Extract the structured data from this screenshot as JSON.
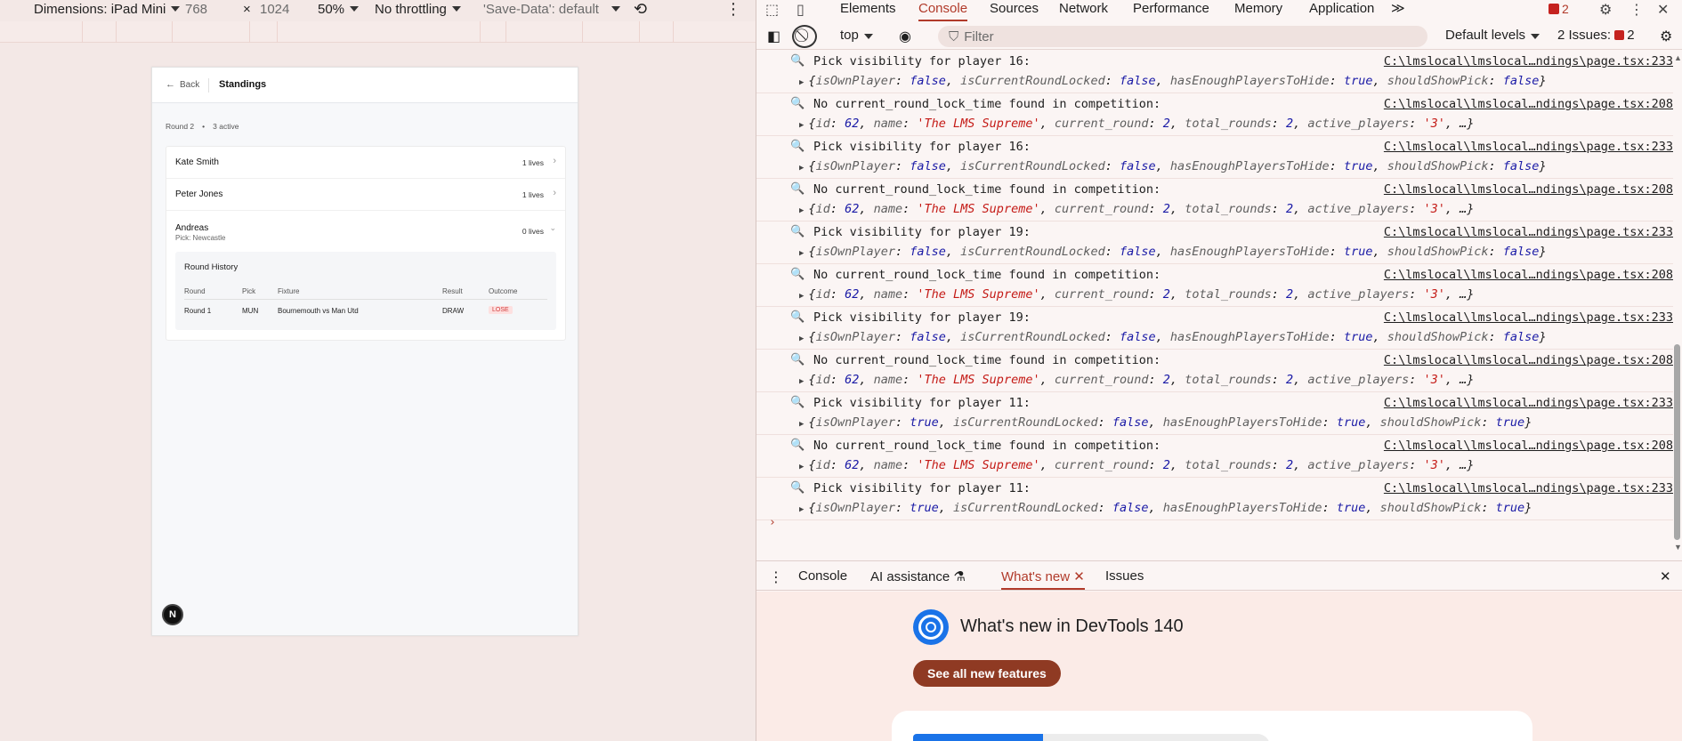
{
  "emulation_toolbar": {
    "dimensions_label": "Dimensions: iPad Mini",
    "width": "768",
    "times": "×",
    "height": "1024",
    "zoom": "50%",
    "throttling": "No throttling",
    "save_data": "'Save-Data': default"
  },
  "app": {
    "back_label": "Back",
    "page_title": "Standings",
    "round_label": "Round 2",
    "separator": "•",
    "active_label": "3 active",
    "players": [
      {
        "name": "Kate Smith",
        "lives": "1 lives"
      },
      {
        "name": "Peter Jones",
        "lives": "1 lives"
      },
      {
        "name": "Andreas",
        "lives": "0 lives",
        "pick": "Pick: Newcastle"
      }
    ],
    "history": {
      "title": "Round History",
      "headers": [
        "Round",
        "Pick",
        "Fixture",
        "Result",
        "Outcome"
      ],
      "rows": [
        {
          "round": "Round 1",
          "pick": "MUN",
          "fixture": "Bournemouth vs Man Utd",
          "result": "DRAW",
          "outcome": "LOSE"
        }
      ]
    },
    "next_badge": "N"
  },
  "devtools": {
    "tabs": [
      "Elements",
      "Console",
      "Sources",
      "Network",
      "Performance",
      "Memory",
      "Application"
    ],
    "active_tab": "Console",
    "more_tabs": "≫",
    "issues_badge": "2",
    "console_toolbar": {
      "context": "top",
      "filter_placeholder": "Filter",
      "levels": "Default levels",
      "issues": "2 Issues:",
      "issues_num": "2"
    },
    "log": [
      {
        "msg": "Pick visibility for player 16:",
        "src": "C:\\lmslocal\\lmslocal…ndings\\page.tsx:233",
        "obj": "pick16"
      },
      {
        "msg": "No current_round_lock_time found in competition:",
        "src": "C:\\lmslocal\\lmslocal…ndings\\page.tsx:208",
        "obj": "comp"
      },
      {
        "msg": "Pick visibility for player 16:",
        "src": "C:\\lmslocal\\lmslocal…ndings\\page.tsx:233",
        "obj": "pick16"
      },
      {
        "msg": "No current_round_lock_time found in competition:",
        "src": "C:\\lmslocal\\lmslocal…ndings\\page.tsx:208",
        "obj": "comp"
      },
      {
        "msg": "Pick visibility for player 19:",
        "src": "C:\\lmslocal\\lmslocal…ndings\\page.tsx:233",
        "obj": "pick19"
      },
      {
        "msg": "No current_round_lock_time found in competition:",
        "src": "C:\\lmslocal\\lmslocal…ndings\\page.tsx:208",
        "obj": "comp"
      },
      {
        "msg": "Pick visibility for player 19:",
        "src": "C:\\lmslocal\\lmslocal…ndings\\page.tsx:233",
        "obj": "pick19"
      },
      {
        "msg": "No current_round_lock_time found in competition:",
        "src": "C:\\lmslocal\\lmslocal…ndings\\page.tsx:208",
        "obj": "comp"
      },
      {
        "msg": "Pick visibility for player 11:",
        "src": "C:\\lmslocal\\lmslocal…ndings\\page.tsx:233",
        "obj": "pick11"
      },
      {
        "msg": "No current_round_lock_time found in competition:",
        "src": "C:\\lmslocal\\lmslocal…ndings\\page.tsx:208",
        "obj": "comp"
      },
      {
        "msg": "Pick visibility for player 11:",
        "src": "C:\\lmslocal\\lmslocal…ndings\\page.tsx:233",
        "obj": "pick11"
      }
    ],
    "prompt": "›",
    "drawer_tabs": [
      "Console",
      "AI assistance",
      "What's new",
      "Issues"
    ],
    "active_drawer_tab": "What's new",
    "whats_new": {
      "title": "What's new in DevTools 140",
      "button": "See all new features"
    },
    "colors": {
      "accent": "#b13a2a",
      "button": "#8f3a23",
      "link_blue": "#1a73e8"
    }
  }
}
